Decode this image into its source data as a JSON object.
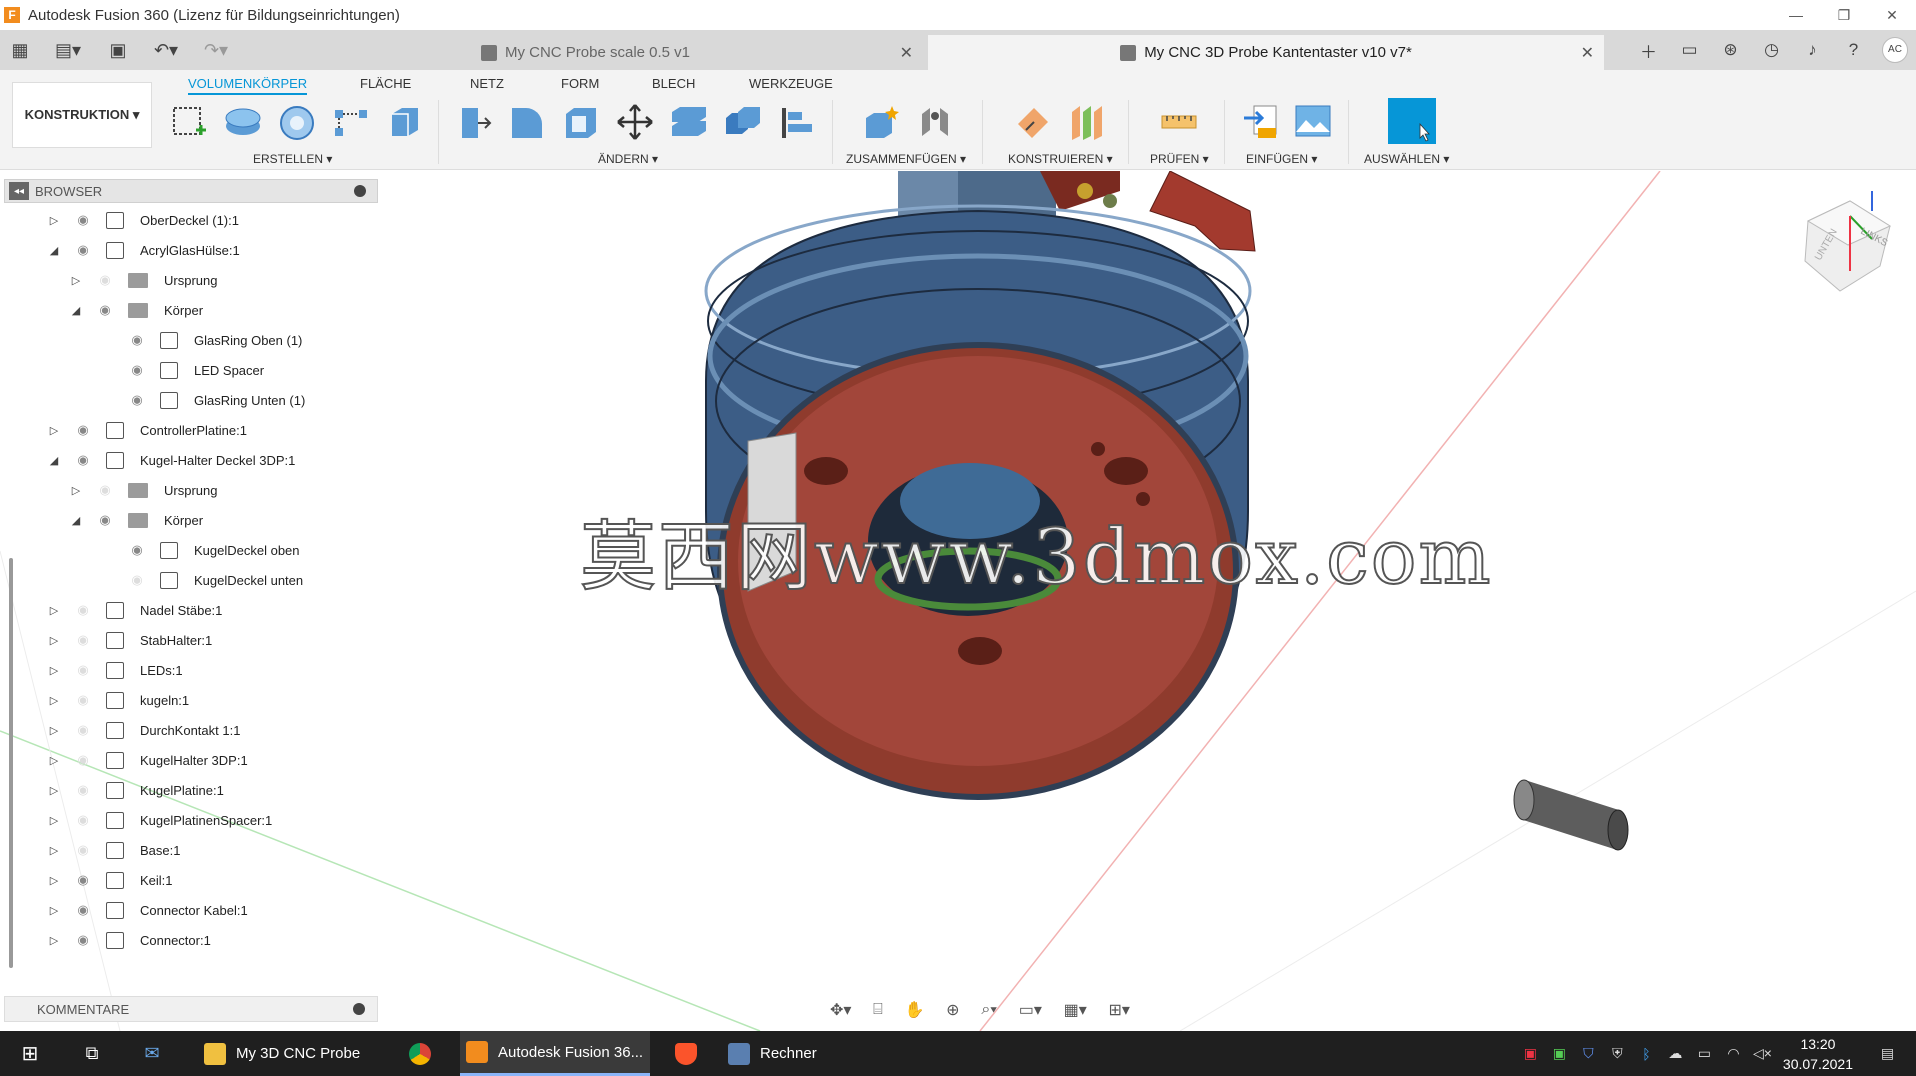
{
  "window": {
    "title": "Autodesk Fusion 360 (Lizenz für Bildungseinrichtungen)"
  },
  "tabs": [
    {
      "label": "My CNC Probe scale 0.5 v1"
    },
    {
      "label": "My CNC 3D Probe Kantentaster v10 v7*"
    }
  ],
  "user": {
    "initials": "AC"
  },
  "toolbar": {
    "workspace": "KONSTRUKTION ▾",
    "tabs": [
      "VOLUMENKÖRPER",
      "FLÄCHE",
      "NETZ",
      "FORM",
      "BLECH",
      "WERKZEUGE"
    ],
    "groups": [
      "ERSTELLEN ▾",
      "ÄNDERN ▾",
      "ZUSAMMENFÜGEN ▾",
      "KONSTRUIEREN ▾",
      "PRÜFEN ▾",
      "EINFÜGEN ▾",
      "AUSWÄHLEN ▾"
    ]
  },
  "browser": {
    "title": "BROWSER",
    "items": [
      {
        "label": "OberDeckel (1):1"
      },
      {
        "label": "AcrylGlasHülse:1"
      },
      {
        "label": "Ursprung"
      },
      {
        "label": "Körper"
      },
      {
        "label": "GlasRing Oben (1)"
      },
      {
        "label": "LED Spacer"
      },
      {
        "label": "GlasRing Unten (1)"
      },
      {
        "label": "ControllerPlatine:1"
      },
      {
        "label": "Kugel-Halter Deckel 3DP:1"
      },
      {
        "label": "Ursprung"
      },
      {
        "label": "Körper"
      },
      {
        "label": "KugelDeckel oben"
      },
      {
        "label": "KugelDeckel unten"
      },
      {
        "label": "Nadel Stäbe:1"
      },
      {
        "label": "StabHalter:1"
      },
      {
        "label": "LEDs:1"
      },
      {
        "label": "kugeln:1"
      },
      {
        "label": "DurchKontakt 1:1"
      },
      {
        "label": "KugelHalter 3DP:1"
      },
      {
        "label": "KugelPlatine:1"
      },
      {
        "label": "KugelPlatinenSpacer:1"
      },
      {
        "label": "Base:1"
      },
      {
        "label": "Keil:1"
      },
      {
        "label": "Connector Kabel:1"
      },
      {
        "label": "Connector:1"
      }
    ]
  },
  "comments": {
    "title": "KOMMENTARE"
  },
  "viewcube": {
    "top": "LINKS",
    "front": "UNTEN"
  },
  "watermark": "莫西网www.3dmox.com",
  "taskbar": {
    "items": [
      "My 3D CNC Probe",
      "Autodesk Fusion 36...",
      "Rechner"
    ],
    "time": "13:20",
    "date": "30.07.2021"
  }
}
